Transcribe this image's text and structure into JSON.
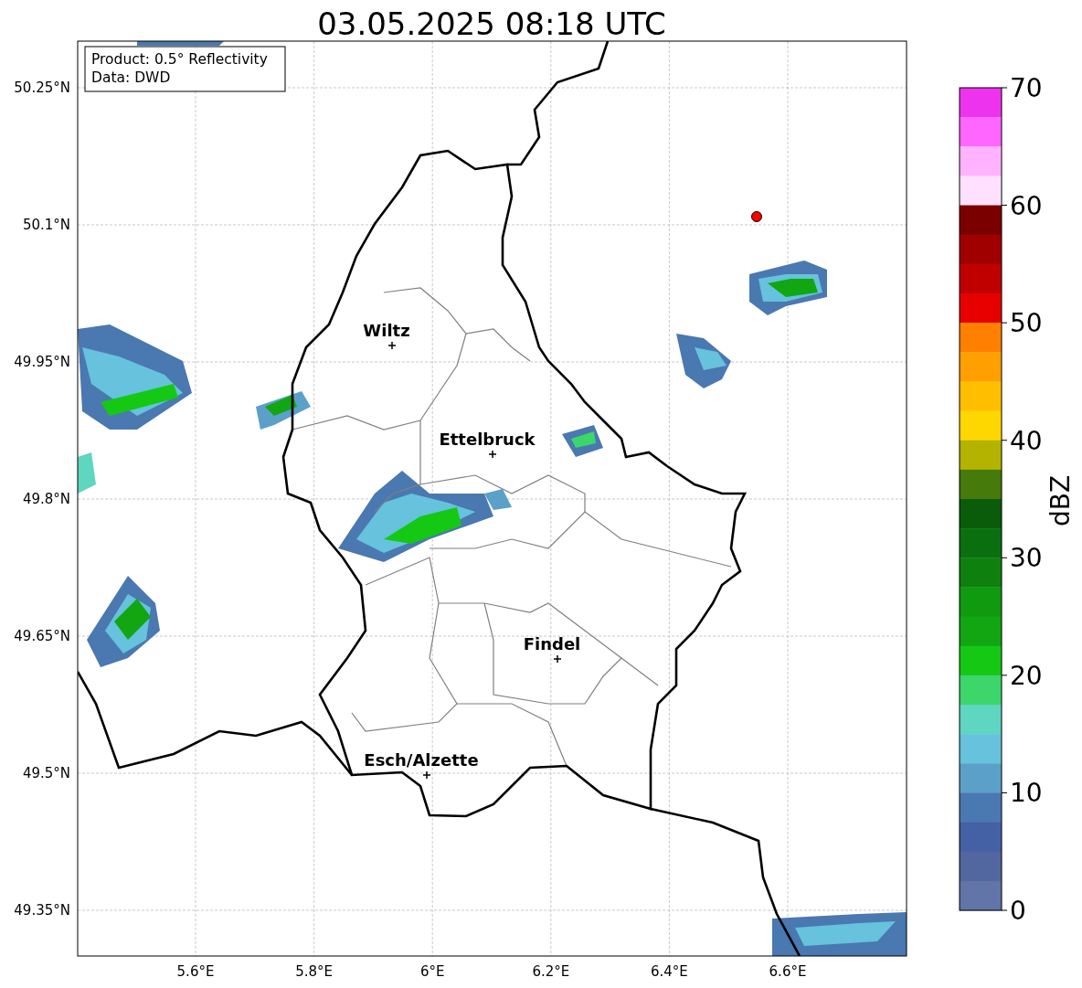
{
  "title": "03.05.2025 08:18 UTC",
  "map": {
    "info_box": [
      "Product: 0.5° Reflectivity",
      "Data: DWD"
    ],
    "x_ticks": [
      "5.6°E",
      "5.8°E",
      "6°E",
      "6.2°E",
      "6.4°E",
      "6.6°E"
    ],
    "y_ticks": [
      "50.25°N",
      "50.1°N",
      "49.95°N",
      "49.8°N",
      "49.65°N",
      "49.5°N",
      "49.35°N"
    ],
    "cities": [
      "Wiltz",
      "Ettelbruck",
      "Findel",
      "Esch/Alzette"
    ]
  },
  "colorbar": {
    "label": "dBZ",
    "ticks": [
      "70",
      "60",
      "50",
      "40",
      "30",
      "20",
      "10",
      "0"
    ],
    "segments": [
      {
        "color": "#ee33ee"
      },
      {
        "color": "#ff66ff"
      },
      {
        "color": "#ffb3ff"
      },
      {
        "color": "#ffe0ff"
      },
      {
        "color": "#7a0000"
      },
      {
        "color": "#a00000"
      },
      {
        "color": "#c00000"
      },
      {
        "color": "#e60000"
      },
      {
        "color": "#ff7f00"
      },
      {
        "color": "#ff9f00"
      },
      {
        "color": "#ffbf00"
      },
      {
        "color": "#ffd700"
      },
      {
        "color": "#b3b300"
      },
      {
        "color": "#467a0a"
      },
      {
        "color": "#0a5c0a"
      },
      {
        "color": "#0a700f"
      },
      {
        "color": "#0e800e"
      },
      {
        "color": "#0f9a0f"
      },
      {
        "color": "#12a612"
      },
      {
        "color": "#14c814"
      },
      {
        "color": "#3cd66b"
      },
      {
        "color": "#5ed6c0"
      },
      {
        "color": "#66c2dd"
      },
      {
        "color": "#5aa0c8"
      },
      {
        "color": "#4a78b0"
      },
      {
        "color": "#4461a5"
      },
      {
        "color": "#52669f"
      },
      {
        "color": "#6275a8"
      }
    ]
  }
}
